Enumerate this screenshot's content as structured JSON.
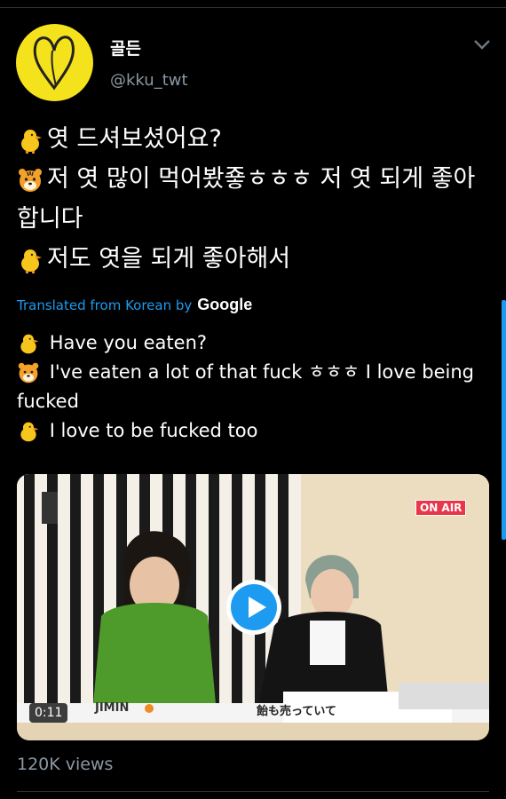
{
  "author": {
    "display_name": "골든",
    "handle": "@kku_twt"
  },
  "tweet": {
    "lines": [
      {
        "emoji": "chick-icon",
        "text": "엿 드셔보셨어요?"
      },
      {
        "emoji": "tiger-icon",
        "text": "저 엿 많이 먹어봤죻ㅎㅎㅎ 저 엿 되게 좋아합니다"
      },
      {
        "emoji": "chick-icon",
        "text": "저도 엿을 되게 좋아해서"
      }
    ]
  },
  "translation": {
    "label": "Translated from Korean by",
    "provider": "Google",
    "lines": [
      {
        "emoji": "chick-icon",
        "text": "Have you eaten?"
      },
      {
        "emoji": "tiger-icon",
        "text": "I've eaten a lot of that fuck ㅎㅎㅎ I love being fucked"
      },
      {
        "emoji": "chick-icon",
        "text": "I love to be fucked too"
      }
    ]
  },
  "media": {
    "duration": "0:11",
    "badge": "ON AIR",
    "caption_name": "JIMIN",
    "caption_text": "飴も売っていて"
  },
  "stats": {
    "views": "120K views"
  },
  "colors": {
    "background": "#000000",
    "accent": "#1d9bf0",
    "secondary_text": "#8b98a5",
    "avatar_yellow": "#f4e21c"
  }
}
